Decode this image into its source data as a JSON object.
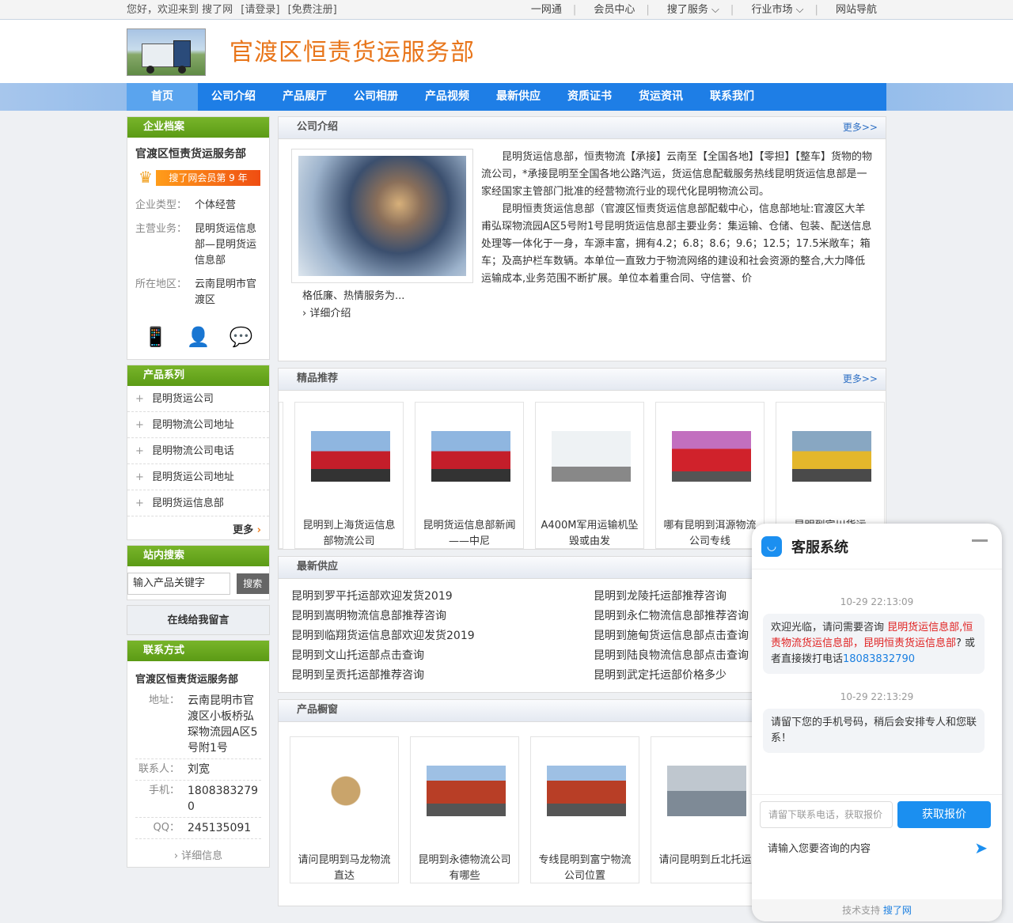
{
  "topbar": {
    "greeting": "您好，欢迎来到 搜了网",
    "login": "[请登录]",
    "register": "[免费注册]",
    "links": [
      "一网通",
      "会员中心",
      "搜了服务 ⌵",
      "行业市场 ⌵",
      "网站导航"
    ]
  },
  "header": {
    "site_name": "官渡区恒责货运服务部"
  },
  "nav": [
    "首页",
    "公司介绍",
    "产品展厅",
    "公司相册",
    "产品视频",
    "最新供应",
    "资质证书",
    "货运资讯",
    "联系我们"
  ],
  "sidebar": {
    "profile_title": "企业档案",
    "company": "官渡区恒责货运服务部",
    "member_badge": "搜了网会员第 9 年",
    "type_k": "企业类型：",
    "type_v": "个体经营",
    "biz_k": "主营业务：",
    "biz_v": "昆明货运信息部—昆明货运信息部",
    "area_k": "所在地区：",
    "area_v": "云南昆明市官渡区",
    "series_title": "产品系列",
    "series": [
      "昆明货运公司",
      "昆明物流公司地址",
      "昆明物流公司电话",
      "昆明货运公司地址",
      "昆明货运信息部"
    ],
    "more": "更多",
    "search_title": "站内搜索",
    "search_placeholder": "输入产品关键字",
    "search_btn": "搜索",
    "message_btn": "在线给我留言",
    "contact_title": "联系方式",
    "contact_company": "官渡区恒责货运服务部",
    "addr_k": "地址：",
    "addr_v": "云南昆明市官渡区小板桥弘琛物流园A区5号附1号",
    "person_k": "联系人：",
    "person_v": "刘宽",
    "phone_k": "手机：",
    "phone_v": "18083832790",
    "qq_k": "QQ：",
    "qq_v": "245135091",
    "detail": "详细信息"
  },
  "intro": {
    "title": "公司介绍",
    "more": "更多>>",
    "p1": "昆明货运信息部，恒责物流【承接】云南至【全国各地】【零担】【整车】货物的物流公司，*承接昆明至全国各地公路汽运，货运信息配载服务热线昆明货运信息部是一家经国家主管部门批准的经营物流行业的现代化昆明物流公司。",
    "p2": "昆明恒责货运信息部（官渡区恒责货运信息部配载中心，信息部地址:官渡区大羊甫弘琛物流园A区5号附1号昆明货运信息部主要业务：集运输、仓储、包装、配送信息处理等一体化于一身，车源丰富，拥有4.2；6.8；8.6；9.6；12.5；17.5米敞车；箱车；及高护栏车数辆。本单位一直致力于物流网络的建设和社会资源的整合,大力降低运输成本,业务范围不断扩展。单位本着重合同、守信誉、价",
    "p3": "格低廉、热情服务为...",
    "detail": "详细介绍"
  },
  "featured": {
    "title": "精品推荐",
    "more": "更多>>",
    "items": [
      "昆明到上海货运信息部物流公司",
      "昆明货运信息部新闻——中尼",
      "A400M军用运输机坠毁或由发",
      "哪有昆明到洱源物流公司专线",
      "昆明到宾川货运"
    ]
  },
  "latest": {
    "title": "最新供应",
    "items": [
      "昆明到罗平托运部欢迎发货2019",
      "昆明到龙陵托运部推荐咨询",
      "昆明到嵩明物流信息部推荐咨询",
      "昆明到永仁物流信息部推荐咨询",
      "昆明到临翔货运信息部欢迎发货2019",
      "昆明到施甸货运信息部点击查询",
      "昆明到文山托运部点击查询",
      "昆明到陆良物流信息部点击查询",
      "昆明到呈贡托运部推荐咨询",
      "昆明到武定托运部价格多少"
    ]
  },
  "window": {
    "title": "产品橱窗",
    "items": [
      "请问昆明到马龙物流直达",
      "昆明到永德物流公司有哪些",
      "专线昆明到富宁物流公司位置",
      "请问昆明到丘北托运"
    ]
  },
  "chat": {
    "title": "客服系统",
    "time1": "10-29 22:13:09",
    "msg1_a": "欢迎光临，请问需要咨询 ",
    "msg1_red": "昆明货运信息部,恒责物流货运信息部，昆明恒责货运信息部",
    "msg1_b": "? 或者直接拨打电话",
    "msg1_phone": "18083832790",
    "time2": "10-29 22:13:29",
    "msg2": "请留下您的手机号码，稍后会安排专人和您联系！",
    "phone_placeholder": "请留下联系电话，获取报价",
    "quote_btn": "获取报价",
    "input_placeholder": "请输入您要咨询的内容",
    "support": "技术支持",
    "brand": "搜了网"
  }
}
